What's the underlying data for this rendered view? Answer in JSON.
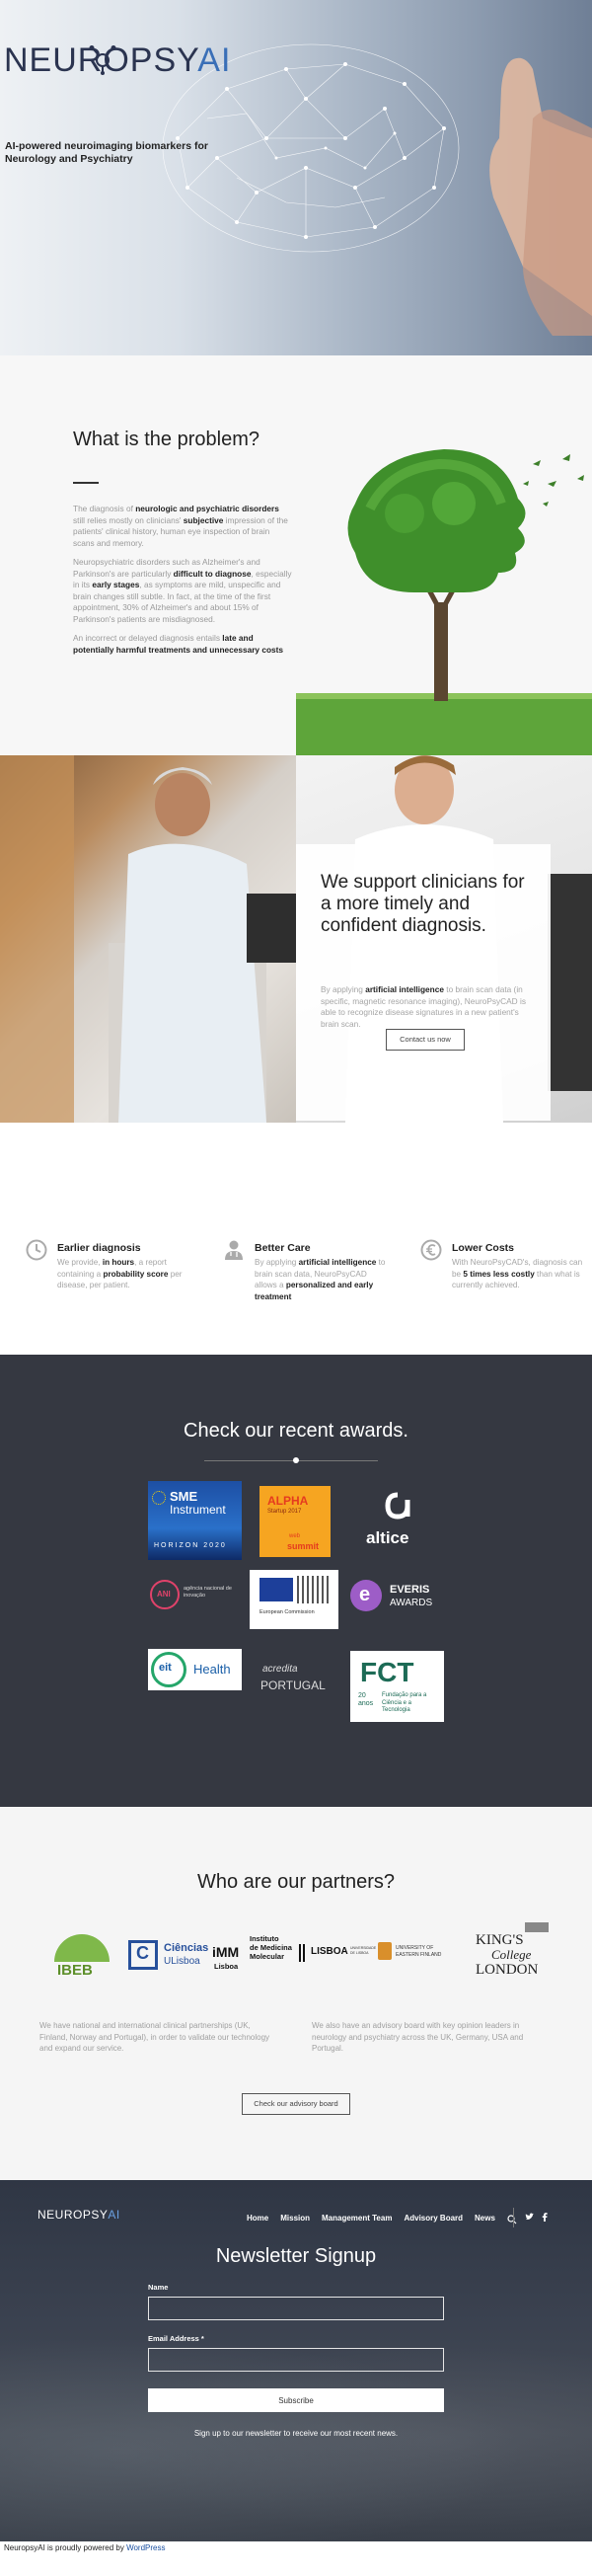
{
  "hero": {
    "logo_text_main": "NEUROPSY",
    "logo_text_ai": "AI",
    "tagline": "AI-powered neuroimaging biomarkers for Neurology and Psychiatry"
  },
  "problem": {
    "title": "What is the problem?",
    "p1_a": "The diagnosis of ",
    "p1_b": "neurologic and psychiatric disorders",
    "p1_c": " still relies mostly on clinicians' ",
    "p1_d": "subjective",
    "p1_e": " impression of the patients' clinical history, human eye inspection of brain scans and memory.",
    "p2_a": "Neuropsychiatric disorders such as Alzheimer's and Parkinson's are particularly ",
    "p2_b": "difficult to diagnose",
    "p2_c": ", especially in its ",
    "p2_d": "early stages",
    "p2_e": ", as symptoms are mild, unspecific and brain changes still subtle. In fact, at the time of the first appointment, 30% of Alzheimer's and about 15% of Parkinson's patients are misdiagnosed.",
    "p3_a": "An incorrect or delayed diagnosis entails ",
    "p3_b": "late and potentially harmful treatments and unnecessary costs"
  },
  "clinicians": {
    "title": "We support clinicians for a more timely and confident diagnosis.",
    "t_a": "By applying ",
    "t_b": "artificial intelligence",
    "t_c": " to brain scan data (in specific, magnetic resonance imaging), NeuroPsyCAD is able to recognize disease signatures in a new patient's brain scan.",
    "button": "Contact us now"
  },
  "features": [
    {
      "icon": "clock-icon",
      "title": "Earlier diagnosis",
      "a": "We provide, ",
      "b": "in hours",
      "c": ", a report containing a ",
      "d": "probability score",
      "e": " per disease, per patient.",
      "f": "",
      "g": ""
    },
    {
      "icon": "doctor-icon",
      "title": "Better Care",
      "a": "By applying ",
      "b": "artificial intelligence",
      "c": " to brain scan data, NeuroPsyCAD allows a ",
      "d": "personalized and early treatment",
      "e": "",
      "f": "",
      "g": ""
    },
    {
      "icon": "euro-icon",
      "title": "Lower Costs",
      "a": "With NeuroPsyCAD's, diagnosis can be ",
      "b": "5 times less costly",
      "c": " than what is currently achieved.",
      "d": "",
      "e": "",
      "f": "",
      "g": ""
    }
  ],
  "awards": {
    "title": "Check our recent awards.",
    "sme_line1": "SME",
    "sme_line2": "Instrument",
    "sme_line3": "HORIZON 2020",
    "alpha_line1": "ALPHA",
    "alpha_line2": "Startup 2017",
    "alpha_line3": "web",
    "alpha_line4": "summit",
    "altice": "altice",
    "ani_line1": "ANI",
    "ani_line2": "agência nacional de inovação",
    "eu_label": "European Commission",
    "everis_line1": "EVERIS",
    "everis_line2": "AWARDS",
    "eit_line1": "eit",
    "eit_line2": "Health",
    "acredita_line1": "acredita",
    "acredita_line2": "PORTUGAL",
    "fct_line1": "FCT",
    "fct_line2": "Fundação para a Ciência e a Tecnologia",
    "fct_line3": "20 anos"
  },
  "partners": {
    "title": "Who are our partners?",
    "ibeb": "IBEB",
    "ciencias_line1": "Ciências",
    "ciencias_line2": "ULisboa",
    "imm_line1": "Instituto",
    "imm_line2": "de Medicina",
    "imm_line3": "Molecular",
    "imm_line4": "Lisboa",
    "lisboa": "LISBOA",
    "lisboa_sub": "UNIVERSIDADE DE LISBOA",
    "uef": "UNIVERSITY OF EASTERN FINLAND",
    "kings_line1": "KING'S",
    "kings_line2": "College",
    "kings_line3": "LONDON",
    "left_text": "We have national and international clinical partnerships (UK, Finland, Norway and Portugal), in order to validate our technology and expand our service.",
    "right_text": "We also have an advisory board with key opinion leaders in neurology and psychiatry across the UK, Germany, USA and Portugal.",
    "button": "Check our advisory board"
  },
  "footer": {
    "logo_main": "NEUROPSY",
    "logo_ai": "AI",
    "nav": [
      "Home",
      "Mission",
      "Management Team",
      "Advisory Board",
      "News"
    ],
    "newsletter_title": "Newsletter Signup",
    "name_label": "Name",
    "email_label": "Email Address *",
    "submit": "Subscribe",
    "note": "Sign up to our newsletter to receive our most recent news."
  },
  "credit": {
    "text": "NeuropsyAI is proudly powered by ",
    "link": "WordPress"
  }
}
